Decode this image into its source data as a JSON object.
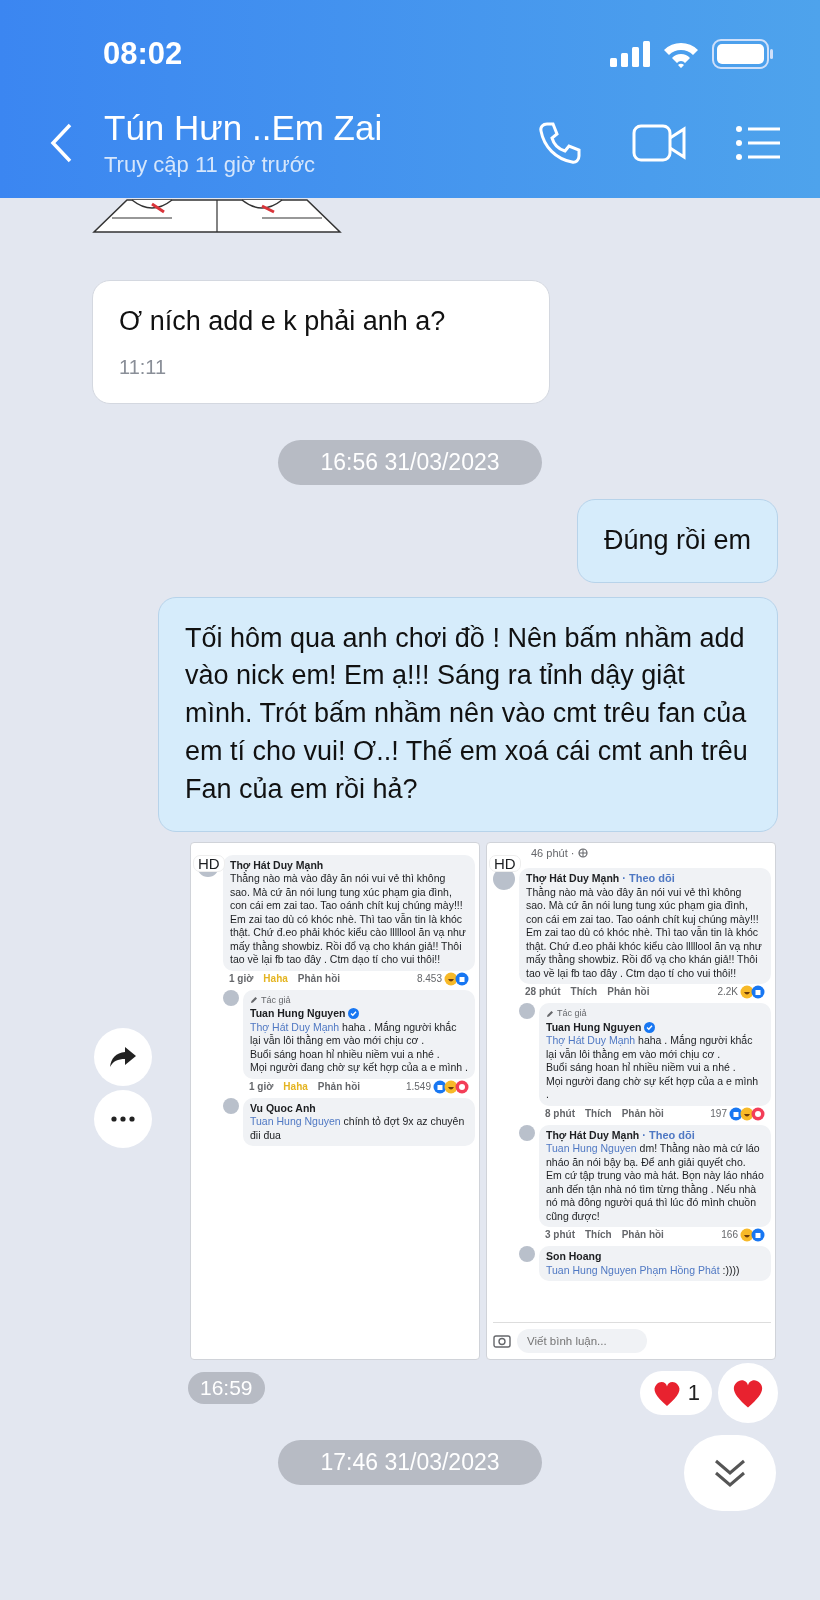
{
  "status_bar": {
    "time": "08:02"
  },
  "header": {
    "title": "Tún Hưn ..Em Zai",
    "subtitle": "Truy cập 11 giờ trước"
  },
  "messages": [
    {
      "kind": "sticker"
    },
    {
      "kind": "text",
      "outgoing": false,
      "text": "Ơ ních add e k phải anh a?",
      "time": "11:11"
    },
    {
      "kind": "date",
      "text": "16:56 31/03/2023"
    },
    {
      "kind": "text",
      "outgoing": true,
      "text": "Đúng rồi em"
    },
    {
      "kind": "text",
      "outgoing": true,
      "text": "Tối hôm qua anh chơi đồ ! Nên bấm nhầm add vào nick em! Em ạ!!! Sáng ra tỉnh dậy giật mình. Trót bấm nhầm nên vào cmt trêu fan của em tí cho vui! Ơ..! Thế em xoá cái cmt anh trêu Fan của em rồi hả?"
    },
    {
      "kind": "images",
      "time": "16:59",
      "reaction_count": "1",
      "images": [
        {
          "hd_badge": "HD",
          "comments": [
            {
              "author": "Thợ Hát Duy Mạnh",
              "text": "Thằng nào mà vào đây ăn nói vui vẻ thì không sao. Mà cứ  ăn nói lung tung xúc phạm gia đình, con cái em zai tao. Tao oánh chít kuj chúng mày!!! Em zai tao dù có khóc nhè. Thì tao vẫn tin là khóc thật. Chứ đ.eo phải khóc kiểu cào lllllool ăn vạ như mấy thằng showbiz. Rồi đổ vạ cho khán giả!! Thôi tao về lại fb tao đây . Ctm dạo tí cho vui thôi!!",
              "time": "1 giờ",
              "like": "Haha",
              "reacted": true,
              "reply": "Phản hồi",
              "count": "8.453",
              "reactions": [
                {
                  "kind": "haha"
                },
                {
                  "kind": "like"
                }
              ],
              "children": [
                {
                  "badge": "Tác giả",
                  "author": "Tuan Hung Nguyen",
                  "verified": true,
                  "mention": "Thợ Hát Duy Mạnh",
                  "text": "haha . Mắng người khắc lại vẫn lôi thằng em vào mới chịu cơ .\nBuổi sáng hoan hỉ nhiều niềm vui a nhé .\nMọi người đang chờ sự kết hợp của a e mình .",
                  "time": "1 giờ",
                  "like": "Haha",
                  "reacted": true,
                  "reply": "Phản hồi",
                  "count": "1.549",
                  "reactions": [
                    {
                      "kind": "like"
                    },
                    {
                      "kind": "haha"
                    },
                    {
                      "kind": "love"
                    }
                  ]
                },
                {
                  "author": "Vu Quoc Anh",
                  "mention": "Tuan Hung Nguyen",
                  "text": "chính tỏ đợt 9x az chuyên đii đua"
                }
              ]
            }
          ]
        },
        {
          "hd_badge": "HD",
          "post_meta": "46 phút ·",
          "comments": [
            {
              "author": "Thợ Hát Duy Mạnh",
              "follow": "· Theo dõi",
              "text": "Thằng nào mà vào đây ăn nói vui vẻ thì không sao. Mà cứ  ăn nói lung tung xúc phạm gia đình, con cái em zai tao. Tao oánh chít kuj chúng mày!!! Em zai tao dù có khóc nhè. Thì tao vẫn tin là khóc thật. Chứ đ.eo phải khóc kiểu cào lllllool ăn vạ như mấy thằng showbiz. Rồi đổ vạ cho khán giả!! Thôi tao về lại fb tao đây . Ctm dạo tí cho vui thôi!!",
              "time": "28 phút",
              "like": "Thích",
              "reacted": false,
              "reply": "Phản hồi",
              "count": "2.2K",
              "reactions": [
                {
                  "kind": "haha"
                },
                {
                  "kind": "like"
                }
              ],
              "children": [
                {
                  "badge": "Tác giả",
                  "author": "Tuan Hung Nguyen",
                  "verified": true,
                  "mention": "Thợ Hát Duy Mạnh",
                  "text": "haha . Mắng người khắc lại vẫn lôi thằng em vào mới chịu cơ .\nBuổi sáng hoan hỉ nhiều niềm vui a nhé .\nMọi người đang chờ sự kết hợp của a e mình\n.",
                  "time": "8 phút",
                  "like": "Thích",
                  "reacted": false,
                  "reply": "Phản hồi",
                  "count": "197",
                  "reactions": [
                    {
                      "kind": "like"
                    },
                    {
                      "kind": "haha"
                    },
                    {
                      "kind": "love"
                    }
                  ]
                },
                {
                  "author": "Thợ Hát Duy Mạnh",
                  "follow": "· Theo dõi",
                  "mention": "Tuan Hung Nguyen",
                  "text": "dm! Thằng nào mà cứ láo nháo ăn nói bậy bạ. Để anh giải quyết cho. Em cứ tập trung vào mà hát. Bọn này láo nháo anh đến tận nhà nó tìm từng thằng . Nếu nhà nó mà đông người quá thì lúc đó mình chuồn cũng được!",
                  "time": "3 phút",
                  "like": "Thích",
                  "reacted": false,
                  "reply": "Phản hồi",
                  "count": "166",
                  "reactions": [
                    {
                      "kind": "haha"
                    },
                    {
                      "kind": "like"
                    }
                  ]
                },
                {
                  "author": "Son Hoang",
                  "mention": "Tuan Hung Nguyen Phạm Hồng Phát",
                  "text": ":))))"
                }
              ]
            }
          ],
          "comment_input": {
            "placeholder": "Viết bình luận..."
          }
        }
      ]
    },
    {
      "kind": "date",
      "text": "17:46 31/03/2023"
    }
  ]
}
